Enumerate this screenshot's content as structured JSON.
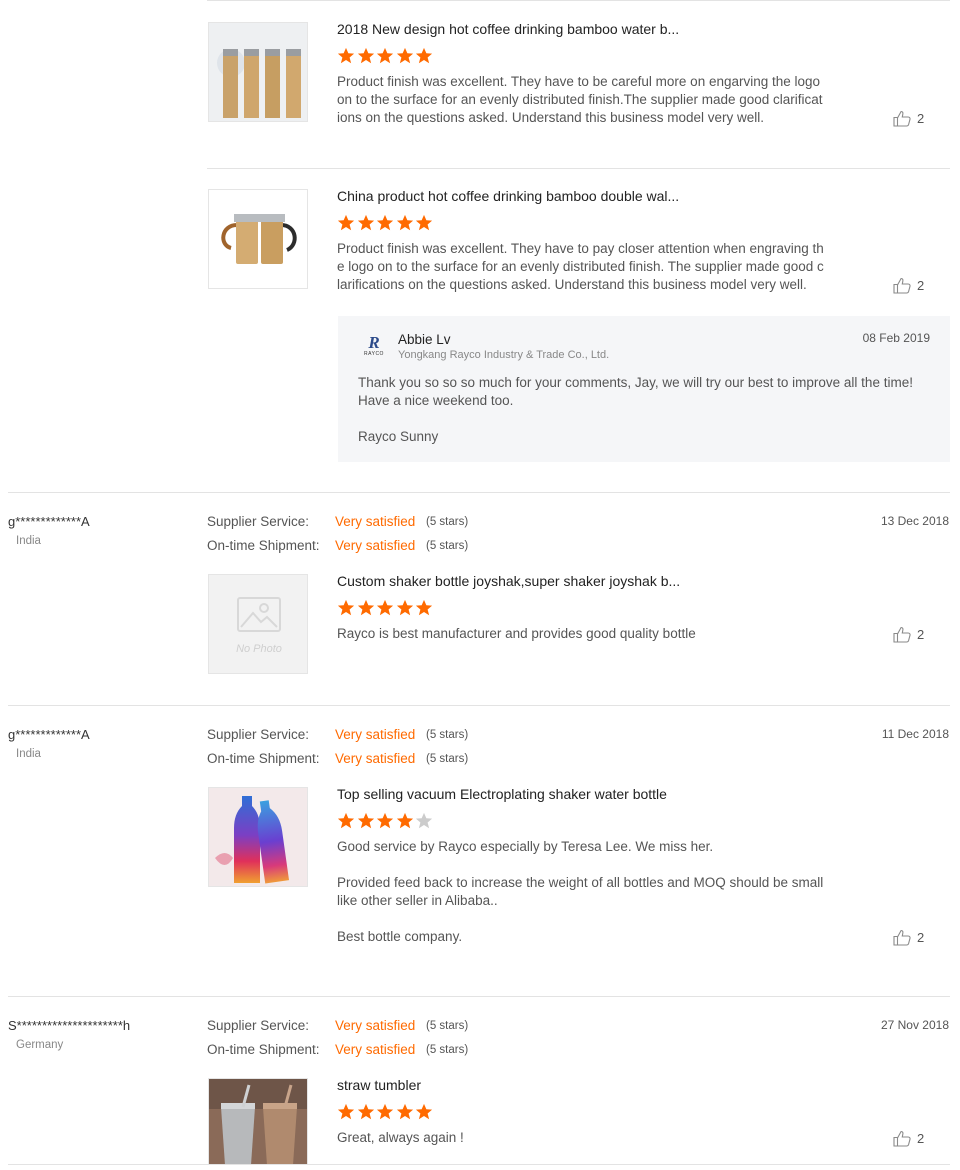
{
  "colors": {
    "accent": "#ff6a00",
    "star_on": "#ff6a00",
    "star_off": "#cccccc"
  },
  "reviews_top": [
    {
      "product_title": "2018 New design hot coffee drinking bamboo water b...",
      "rating": 5,
      "text": "Product finish was excellent. They have to be careful more on engarving the logo\non to the surface for an evenly distributed finish.The supplier made good clarificat\nions on the questions asked. Understand this business model very well.",
      "likes": "2"
    },
    {
      "product_title": "China product hot coffee drinking bamboo double wal...",
      "rating": 5,
      "text": "Product finish was excellent. They have to pay closer attention when engraving th\ne logo on to the surface for an evenly distributed finish. The supplier made good c\nlarifications on the questions asked. Understand this business model very well.",
      "likes": "2"
    }
  ],
  "reply": {
    "author": "Abbie Lv",
    "company": "Yongkang Rayco Industry & Trade Co., Ltd.",
    "logo_text": "RAYCO",
    "date": "08 Feb 2019",
    "line1": "Thank you so so so much for your comments, Jay, we will try our best to improve all the time!",
    "line2": "Have a nice weekend too.",
    "signature": "Rayco Sunny"
  },
  "labels": {
    "supplier_service": "Supplier Service:",
    "on_time_shipment": "On-time Shipment:",
    "no_photo": "No Photo"
  },
  "reviews": [
    {
      "user": "g*************A",
      "country": "India",
      "date": "13 Dec 2018",
      "supplier_service": "Very satisfied",
      "supplier_service_stars": "(5 stars)",
      "shipment": "Very satisfied",
      "shipment_stars": "(5 stars)",
      "product_title": "Custom shaker bottle joyshak,super shaker joyshak b...",
      "rating": 5,
      "text": "Rayco is best manufacturer and provides good quality bottle",
      "likes": "2"
    },
    {
      "user": "g*************A",
      "country": "India",
      "date": "11 Dec 2018",
      "supplier_service": "Very satisfied",
      "supplier_service_stars": "(5 stars)",
      "shipment": "Very satisfied",
      "shipment_stars": "(5 stars)",
      "product_title": "Top selling vacuum Electroplating shaker water bottle",
      "rating": 4,
      "text": "Good service by Rayco especially by Teresa Lee. We miss her.\n\nProvided feed back to increase the weight of all bottles and MOQ should be small\nlike other seller in Alibaba..\n\nBest bottle company.",
      "likes": "2"
    },
    {
      "user": "S*********************h",
      "country": "Germany",
      "date": "27 Nov 2018",
      "supplier_service": "Very satisfied",
      "supplier_service_stars": "(5 stars)",
      "shipment": "Very satisfied",
      "shipment_stars": "(5 stars)",
      "product_title": "straw tumbler",
      "rating": 5,
      "text": "Great, always again !",
      "likes": "2"
    }
  ]
}
